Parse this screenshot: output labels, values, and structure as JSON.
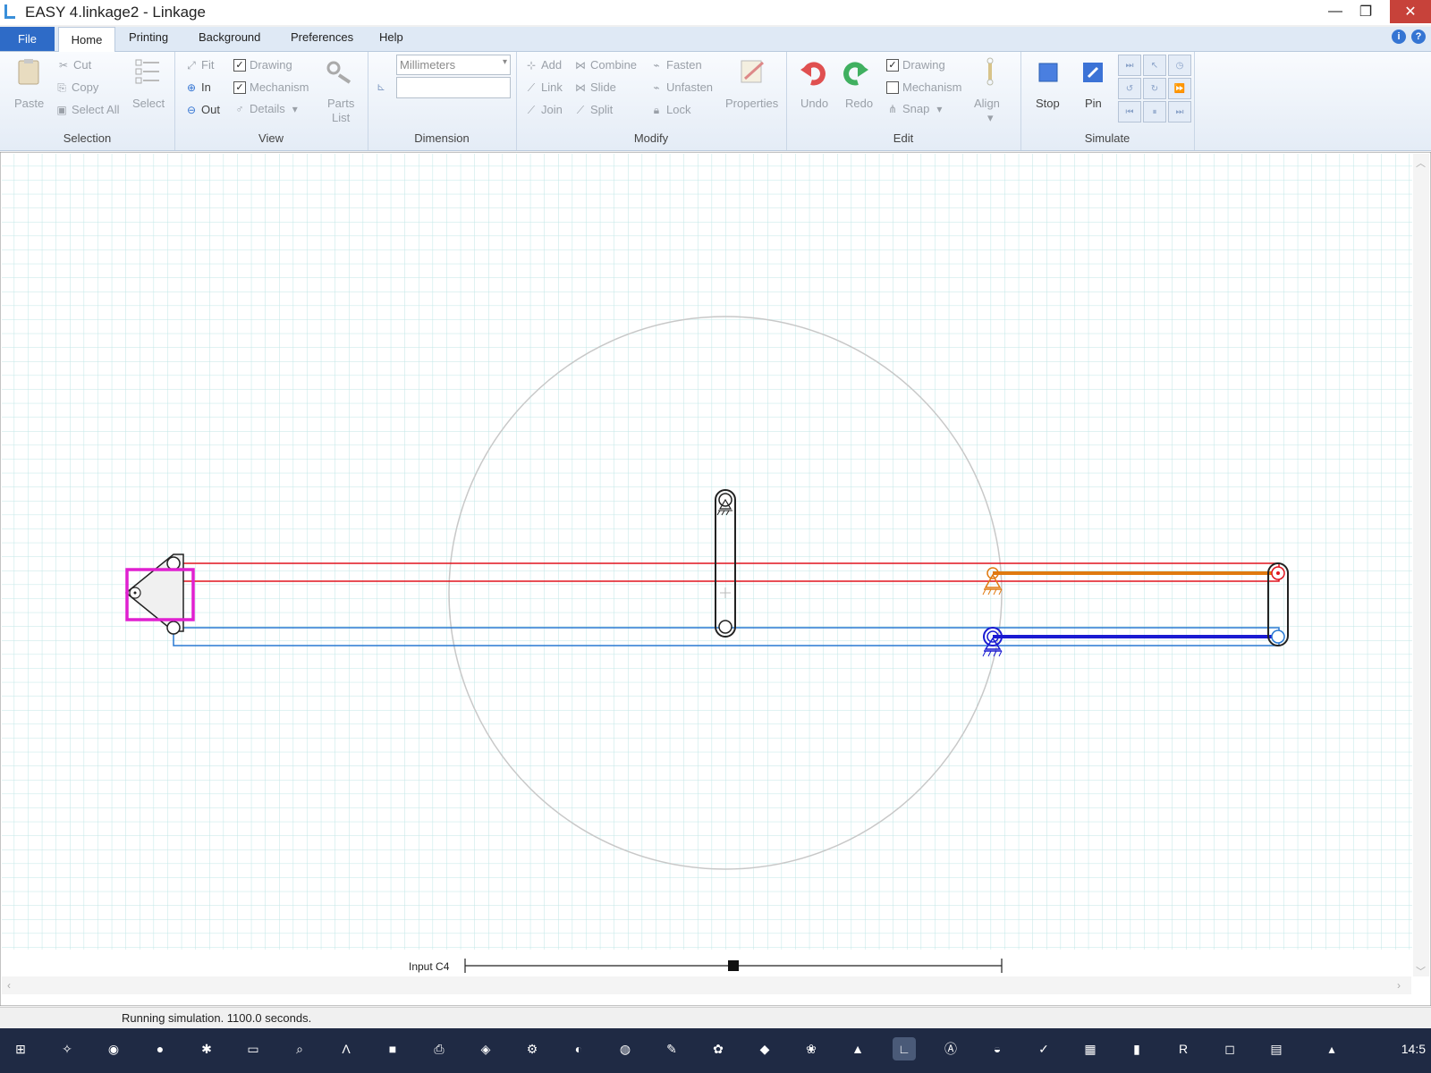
{
  "window": {
    "title": "EASY 4.linkage2 - Linkage",
    "minimize": "—",
    "maximize": "❐",
    "close": "✕"
  },
  "menu": {
    "file": "File",
    "home": "Home",
    "printing": "Printing",
    "background": "Background",
    "preferences": "Preferences",
    "help": "Help"
  },
  "ribbon": {
    "selection": {
      "label": "Selection",
      "paste": "Paste",
      "cut": "Cut",
      "copy": "Copy",
      "select_all": "Select All",
      "select": "Select"
    },
    "view": {
      "label": "View",
      "fit": "Fit",
      "in": "In",
      "out": "Out",
      "drawing": "Drawing",
      "mechanism": "Mechanism",
      "details": "Details",
      "parts_list_1": "Parts",
      "parts_list_2": "List",
      "drawing_checked": true,
      "mechanism_checked": true
    },
    "dimension": {
      "label": "Dimension",
      "units": "Millimeters",
      "value": ""
    },
    "modify": {
      "label": "Modify",
      "add": "Add",
      "link": "Link",
      "join": "Join",
      "combine": "Combine",
      "slide": "Slide",
      "split": "Split",
      "fasten": "Fasten",
      "unfasten": "Unfasten",
      "lock": "Lock",
      "properties": "Properties"
    },
    "edit": {
      "label": "Edit",
      "undo": "Undo",
      "redo": "Redo",
      "drawing": "Drawing",
      "mechanism": "Mechanism",
      "snap": "Snap",
      "align": "Align",
      "drawing_checked": true,
      "mechanism_checked": false
    },
    "simulate": {
      "label": "Simulate",
      "stop": "Stop",
      "pin": "Pin"
    }
  },
  "canvas": {
    "input_label": "Input C4",
    "input_value_fraction": 0.5
  },
  "status": {
    "text": "Running simulation. 1100.0 seconds."
  },
  "taskbar": {
    "clock": "14:5"
  },
  "colors": {
    "grid": "#bfe6e6",
    "red_link": "#e0141e",
    "blue_link": "#2878d2",
    "orange": "#e07a10",
    "dark_blue": "#1a1ad2",
    "magenta": "#e020d0"
  }
}
